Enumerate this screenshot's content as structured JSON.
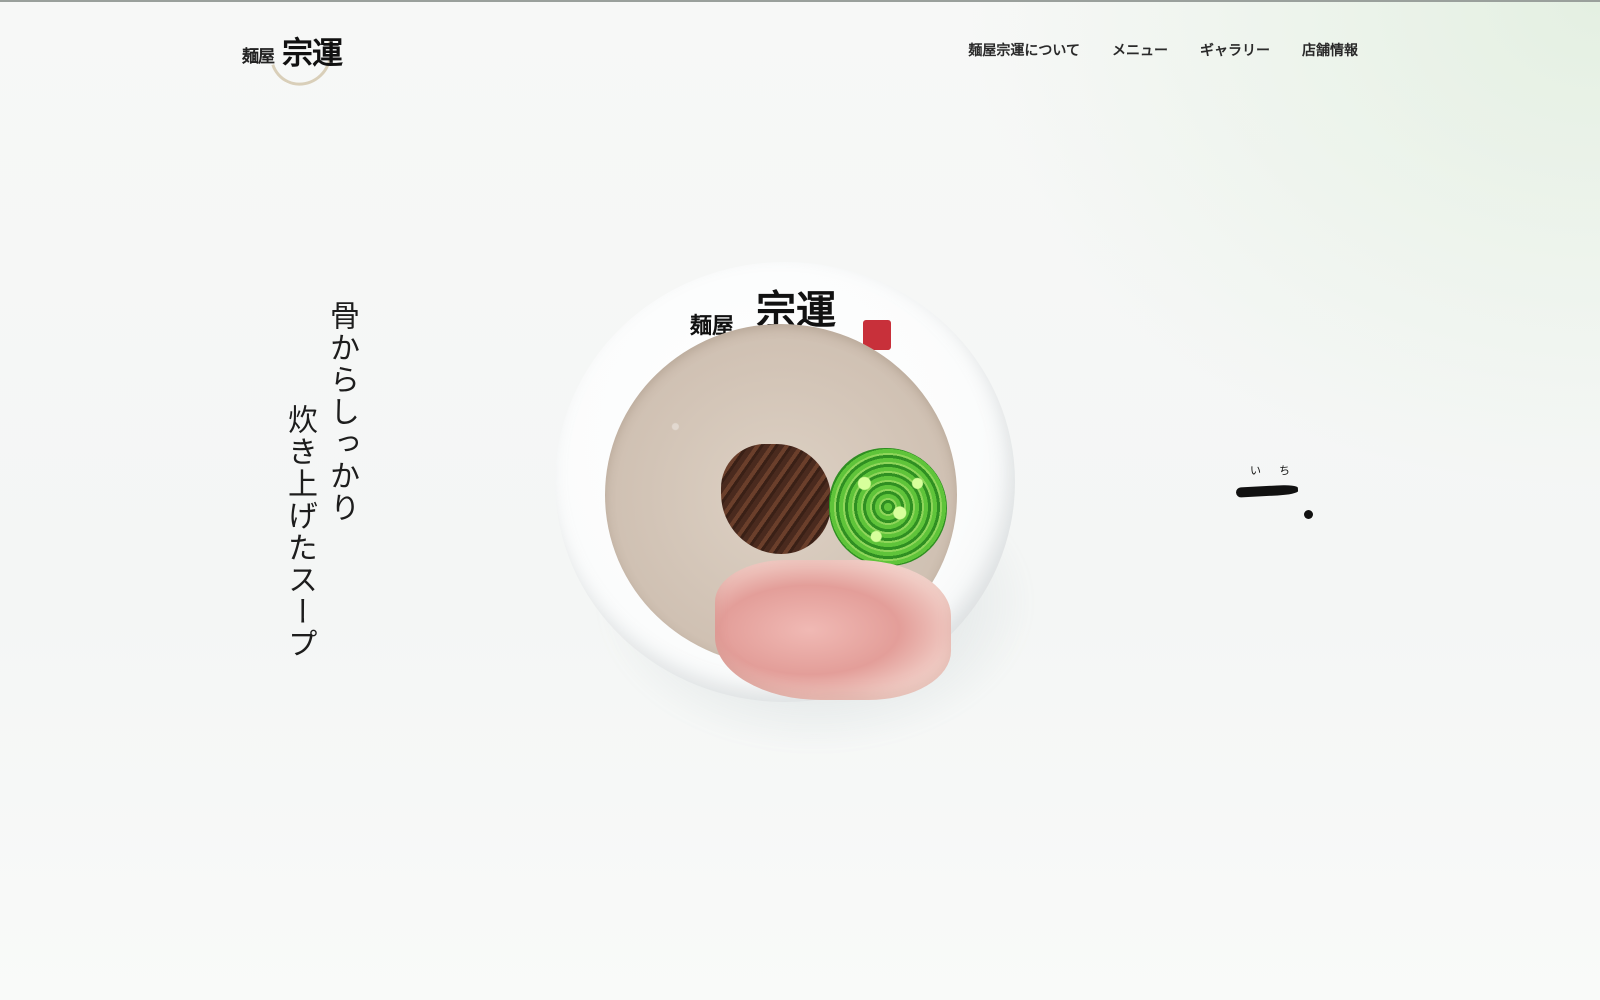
{
  "header": {
    "logo_small": "麺屋",
    "logo_big": "宗運"
  },
  "nav": {
    "items": [
      {
        "label": "麺屋宗運について"
      },
      {
        "label": "メニュー"
      },
      {
        "label": "ギャラリー"
      },
      {
        "label": "店舗情報"
      }
    ]
  },
  "hero": {
    "tagline_line1": "骨からしっかり",
    "tagline_line2": "炊き上げたスープ",
    "bowl_text_small": "麺屋",
    "bowl_text_big": "宗運",
    "ichi_ruby": "いち"
  },
  "colors": {
    "text": "#1d1d1d",
    "background": "#f6f7f6",
    "accent_green": "#e4f0e2"
  }
}
